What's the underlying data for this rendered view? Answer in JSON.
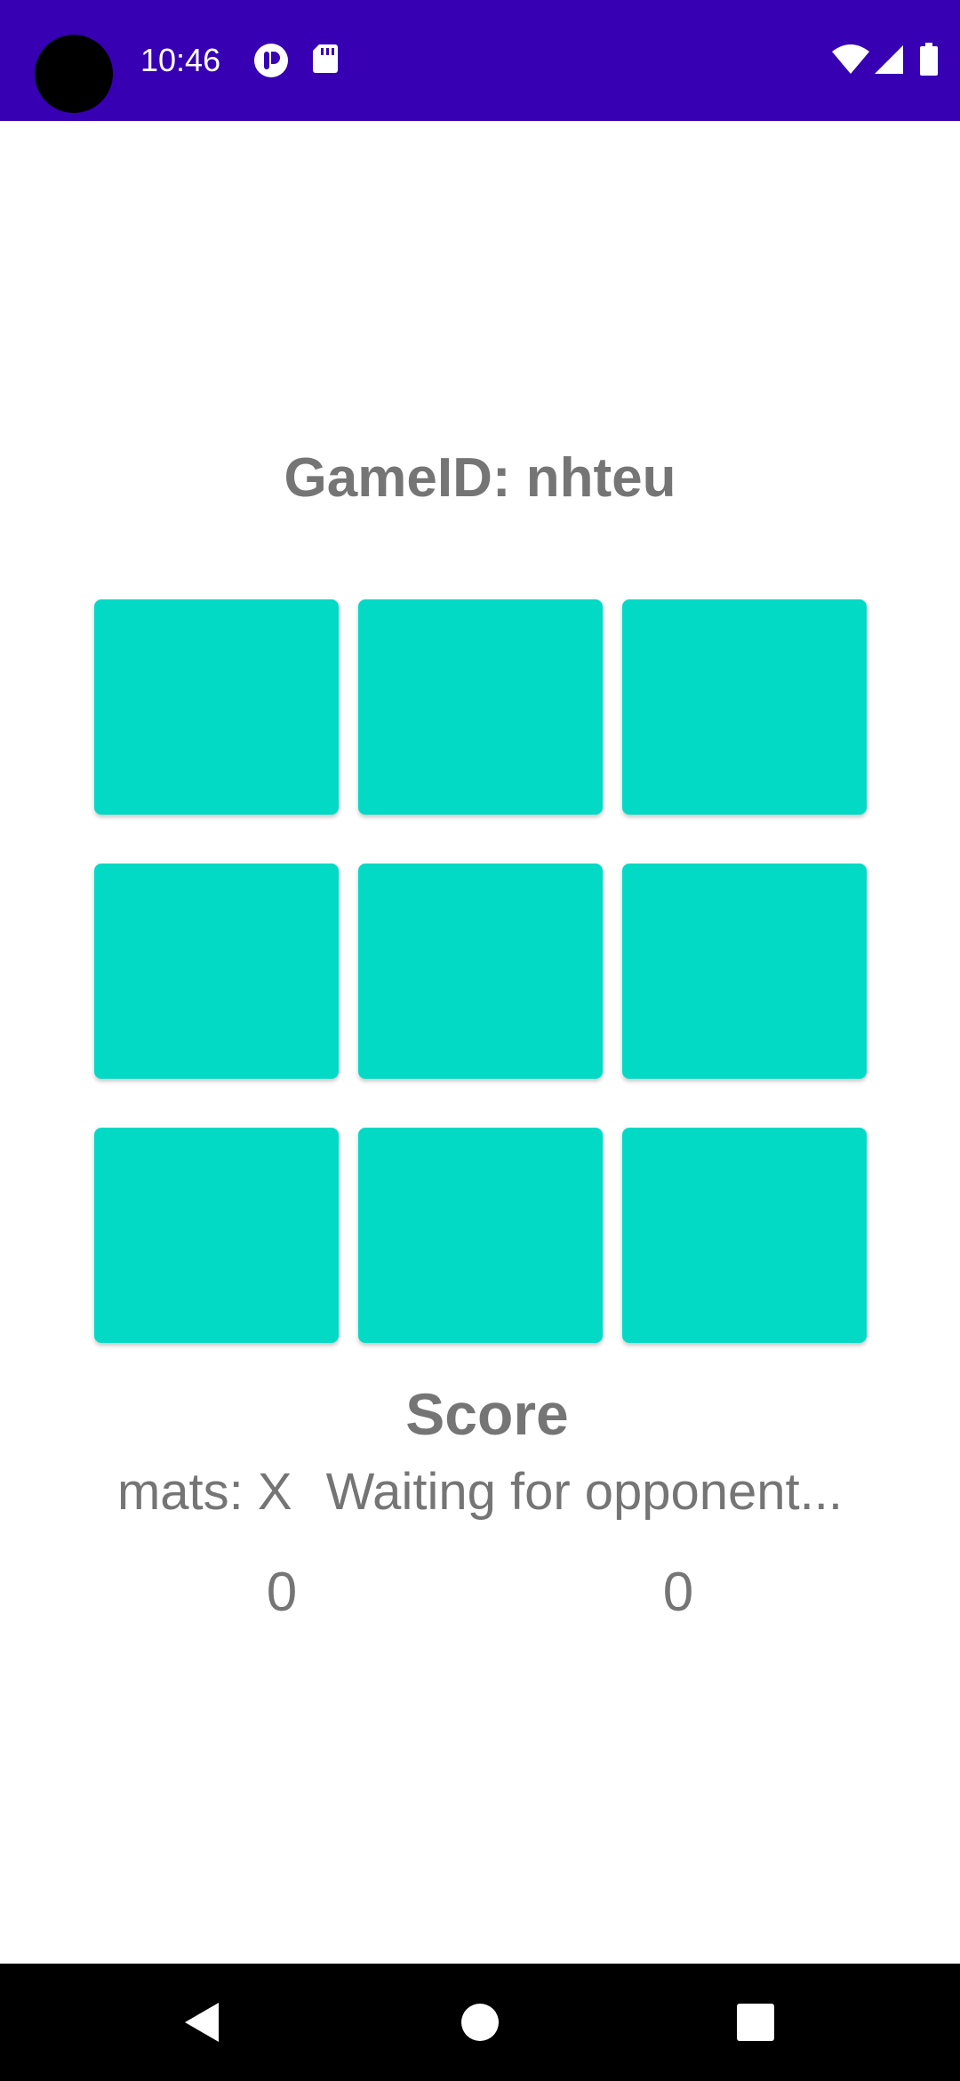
{
  "status_bar": {
    "time": "10:46",
    "background": "#3700b3",
    "icons_left": [
      "app-notification-icon",
      "sd-card-icon"
    ],
    "icons_right": [
      "wifi-icon",
      "cell-signal-icon",
      "battery-icon"
    ]
  },
  "game": {
    "game_id_label": "GameID: nhteu",
    "cell_color": "#03dac5",
    "cells": [
      "",
      "",
      "",
      "",
      "",
      "",
      "",
      "",
      ""
    ]
  },
  "score": {
    "title": "Score",
    "player_one": "mats: X",
    "player_two": "Waiting for opponent...",
    "player_one_score": "0",
    "player_two_score": "0"
  },
  "nav_bar": {
    "buttons": [
      "back-icon",
      "home-icon",
      "recents-icon"
    ]
  }
}
